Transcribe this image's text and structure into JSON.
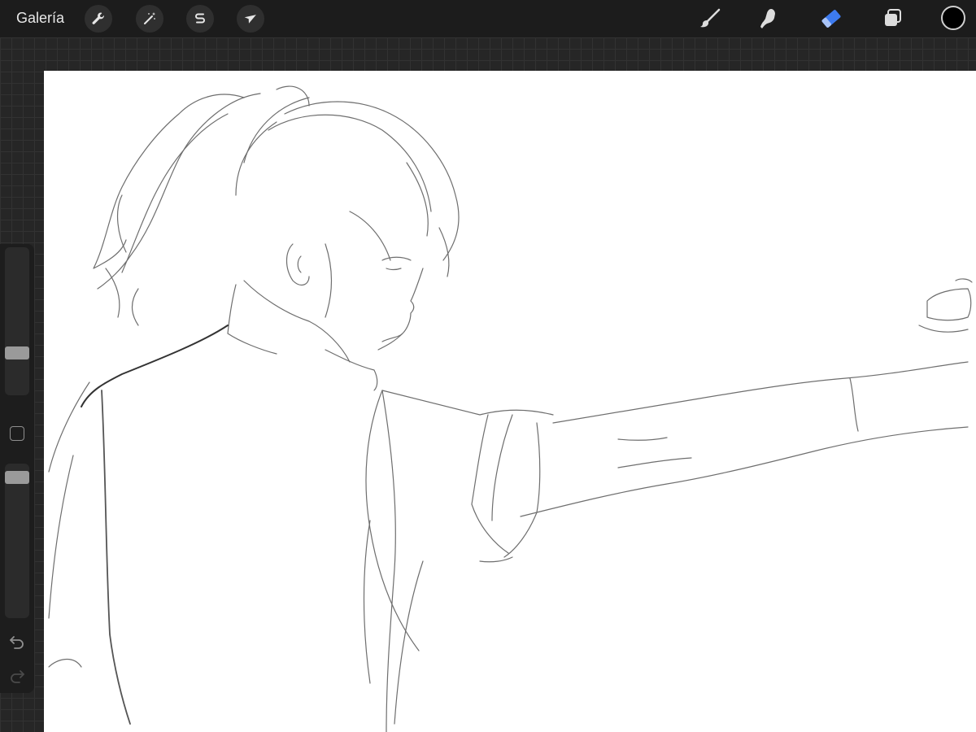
{
  "topbar": {
    "gallery_label": "Galería",
    "left_tools": [
      {
        "name": "actions",
        "icon": "wrench-icon"
      },
      {
        "name": "adjustments",
        "icon": "magic-wand-icon"
      },
      {
        "name": "selection",
        "icon": "selection-s-icon"
      },
      {
        "name": "transform",
        "icon": "arrow-cursor-icon"
      }
    ],
    "right_tools": [
      {
        "name": "brush",
        "icon": "brush-icon",
        "active": false
      },
      {
        "name": "smudge",
        "icon": "smudge-finger-icon",
        "active": false
      },
      {
        "name": "eraser",
        "icon": "eraser-icon",
        "active": true
      },
      {
        "name": "layers",
        "icon": "layers-icon",
        "active": false
      }
    ],
    "current_color": "#000000",
    "active_color": "#3d7bf0"
  },
  "sidebar": {
    "brush_size_icon": "size-slider",
    "brush_opacity_icon": "opacity-slider",
    "undo_icon": "undo-icon",
    "redo_icon": "redo-icon"
  },
  "canvas": {
    "content": "pencil-sketch",
    "background": "#ffffff"
  }
}
